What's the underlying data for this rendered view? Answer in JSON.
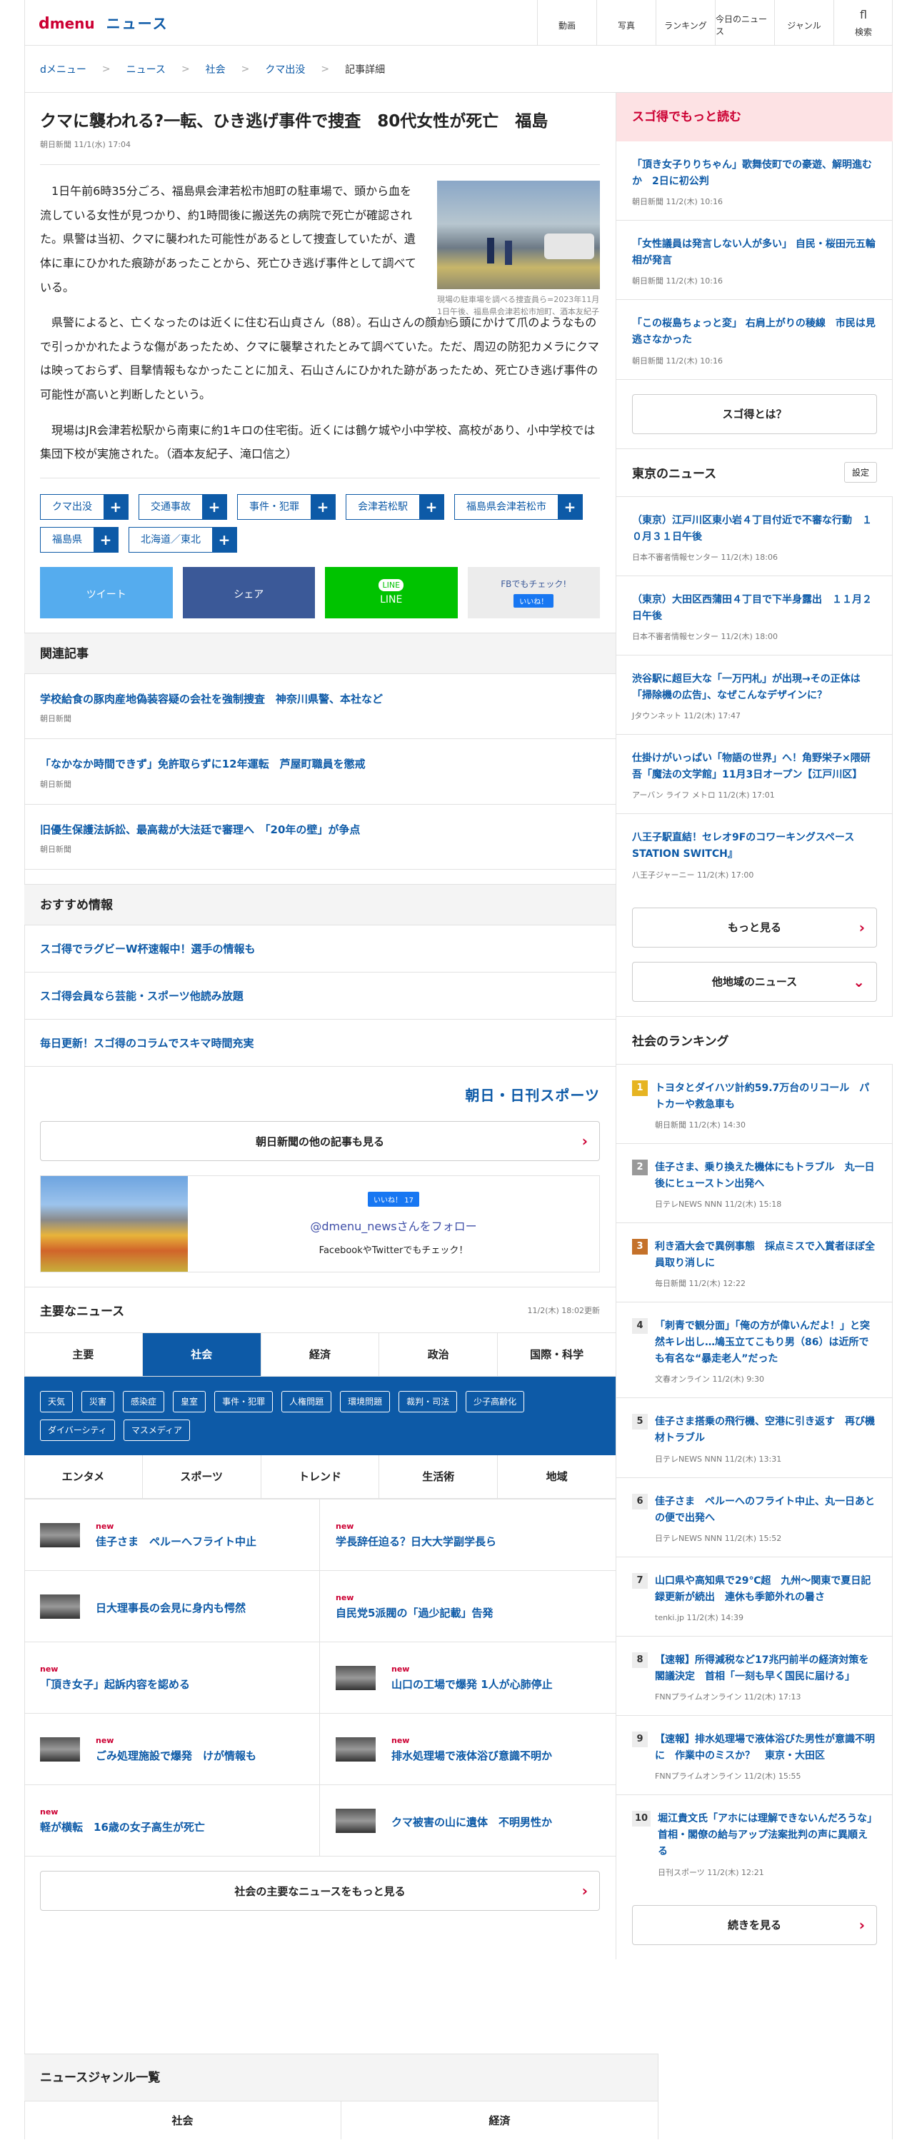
{
  "header": {
    "logo_d": "d",
    "logo_menu": "menu",
    "section": "ニュース",
    "nav": [
      {
        "icon": "",
        "label": "動画"
      },
      {
        "icon": "",
        "label": "写真"
      },
      {
        "icon": "",
        "label": "ランキング"
      },
      {
        "icon": "",
        "label": "今日のニュース"
      },
      {
        "icon": "",
        "label": "ジャンル"
      },
      {
        "icon": "fl",
        "label": "検索"
      }
    ]
  },
  "breadcrumb": [
    "dメニュー",
    "ニュース",
    "社会",
    "クマ出没",
    "記事詳細"
  ],
  "article": {
    "title": "クマに襲われる?一転、ひき逃げ事件で捜査　80代女性が死亡　福島",
    "meta": "朝日新聞 11/1(水) 17:04",
    "photo_caption": "現場の駐車場を調べる捜査員ら=2023年11月1日午後、福島県会津若松市旭町、酒本友紀子撮影",
    "paragraphs": [
      "1日午前6時35分ごろ、福島県会津若松市旭町の駐車場で、頭から血を流している女性が見つかり、約1時間後に搬送先の病院で死亡が確認された。県警は当初、クマに襲われた可能性があるとして捜査していたが、遺体に車にひかれた痕跡があったことから、死亡ひき逃げ事件として調べている。",
      "県警によると、亡くなったのは近くに住む石山貞さん（88）。石山さんの顔から頭にかけて爪のようなもので引っかかれたような傷があったため、クマに襲撃されたとみて調べていた。ただ、周辺の防犯カメラにクマは映っておらず、目撃情報もなかったことに加え、石山さんにひかれた跡があったため、死亡ひき逃げ事件の可能性が高いと判断したという。",
      "現場はJR会津若松駅から南東に約1キロの住宅街。近くには鶴ケ城や小中学校、高校があり、小中学校では集団下校が実施された。（酒本友紀子、滝口信之）"
    ],
    "tags": [
      "クマ出没",
      "交通事故",
      "事件・犯罪",
      "会津若松駅",
      "福島県会津若松市",
      "福島県",
      "北海道／東北"
    ],
    "share": {
      "tweet": "ツイート",
      "share": "シェア",
      "line": "LINE",
      "fb_check": "FBでもチェック!",
      "like": "いいね！"
    }
  },
  "related": {
    "heading": "関連記事",
    "items": [
      {
        "title": "学校給食の豚肉産地偽装容疑の会社を強制捜査　神奈川県警、本社など",
        "source": "朝日新聞"
      },
      {
        "title": "「なかなか時間できず」免許取らずに12年運転　芦屋町職員を懲戒",
        "source": "朝日新聞"
      },
      {
        "title": "旧優生保護法訴訟、最高裁が大法廷で審理へ　「20年の壁」が争点",
        "source": "朝日新聞"
      }
    ]
  },
  "recommend": {
    "heading": "おすすめ情報",
    "items": [
      "スゴ得でラグビーW杯速報中！選手の情報も",
      "スゴ得会員なら芸能・スポーツ他読み放題",
      "毎日更新！スゴ得のコラムでスキマ時間充実"
    ],
    "brand": "朝日・日刊スポーツ",
    "more_button": "朝日新聞の他の記事も見る"
  },
  "fb_follow": {
    "like": "いいね！ 17",
    "handle": "@dmenu_newsさんをフォロー",
    "sub": "FacebookやTwitterでもチェック！"
  },
  "top_news": {
    "heading": "主要なニュース",
    "updated": "11/2(木) 18:02更新",
    "tabs_row1": [
      "主要",
      "社会",
      "経済",
      "政治",
      "国際・科学"
    ],
    "tabs_row2": [
      "エンタメ",
      "スポーツ",
      "トレンド",
      "生活術",
      "地域"
    ],
    "subtags": [
      "天気",
      "災害",
      "感染症",
      "皇室",
      "事件・犯罪",
      "人権問題",
      "環境問題",
      "裁判・司法",
      "少子高齢化",
      "ダイバーシティ",
      "マスメディア"
    ],
    "items": [
      {
        "new": "new",
        "title": "佳子さま　ペルーへフライト中止",
        "thumb": true
      },
      {
        "new": "new",
        "title": "学長辞任迫る？日大大学副学長ら",
        "thumb": false
      },
      {
        "new": "",
        "title": "日大理事長の会見に身内も愕然",
        "thumb": true
      },
      {
        "new": "new",
        "title": "自民党5派閥の「過少記載」告発",
        "thumb": false
      },
      {
        "new": "new",
        "title": "「頂き女子」起訴内容を認める",
        "thumb": false
      },
      {
        "new": "new",
        "title": "山口の工場で爆発 1人が心肺停止",
        "thumb": true
      },
      {
        "new": "new",
        "title": "ごみ処理施設で爆発　けが情報も",
        "thumb": true
      },
      {
        "new": "new",
        "title": "排水処理場で液体浴び意識不明か",
        "thumb": true
      },
      {
        "new": "new",
        "title": "軽が横転　16歳の女子高生が死亡",
        "thumb": false
      },
      {
        "new": "",
        "title": "クマ被害の山に遺体　不明男性か",
        "thumb": true
      }
    ],
    "more_button": "社会の主要なニュースをもっと見る"
  },
  "genre": {
    "heading": "ニュースジャンル一覧",
    "items": [
      "社会",
      "経済"
    ]
  },
  "sidebar": {
    "sugotoku": {
      "heading": "スゴ得でもっと読む",
      "items": [
        {
          "title": "「頂き女子りりちゃん」歌舞伎町での豪遊、解明進むか　2日に初公判",
          "meta": "朝日新聞 11/2(木) 10:16"
        },
        {
          "title": "「女性議員は発言しない人が多い」 自民・桜田元五輪相が発言",
          "meta": "朝日新聞 11/2(木) 10:16"
        },
        {
          "title": "「この桜島ちょっと変」 右肩上がりの稜線　市民は見逃さなかった",
          "meta": "朝日新聞 11/2(木) 10:16"
        }
      ],
      "button": "スゴ得とは？"
    },
    "tokyo": {
      "heading": "東京のニュース",
      "settings": "設定",
      "items": [
        {
          "title": "（東京）江戸川区東小岩４丁目付近で不審な行動　１０月３１日午後",
          "meta": "日本不審者情報センター 11/2(木) 18:06"
        },
        {
          "title": "（東京）大田区西蒲田４丁目で下半身露出　１１月２日午後",
          "meta": "日本不審者情報センター 11/2(木) 18:00"
        },
        {
          "title": "渋谷駅に超巨大な「一万円札」が出現→その正体は「掃除機の広告」、なぜこんなデザインに？",
          "meta": "Jタウンネット 11/2(木) 17:47"
        },
        {
          "title": "仕掛けがいっぱい「物語の世界」へ！角野栄子×隈研吾「魔法の文学館」11月3日オープン【江戸川区】",
          "meta": "アーバン ライフ メトロ 11/2(木) 17:01"
        },
        {
          "title": "八王子駅直結！セレオ9FのコワーキングスペースSTATION SWITCH』",
          "meta": "八王子ジャーニー 11/2(木) 17:00"
        }
      ],
      "more": "もっと見る",
      "other": "他地域のニュース"
    },
    "ranking": {
      "heading": "社会のランキング",
      "items": [
        {
          "rank": "1",
          "title": "トヨタとダイハツ計約59.7万台のリコール　パトカーや救急車も",
          "meta": "朝日新聞 11/2(木) 14:30"
        },
        {
          "rank": "2",
          "title": "佳子さま、乗り換えた機体にもトラブル　丸一日後にヒューストン出発へ",
          "meta": "日テレNEWS NNN 11/2(木) 15:18"
        },
        {
          "rank": "3",
          "title": "利き酒大会で異例事態　採点ミスで入賞者ほぼ全員取り消しに",
          "meta": "毎日新聞 11/2(木) 12:22"
        },
        {
          "rank": "4",
          "title": "「刺青で観分面」「俺の方が偉いんだよ！」と突然キレ出し…鳩玉立てこもり男（86）は近所でも有名な“暴走老人”だった",
          "meta": "文春オンライン 11/2(木) 9:30"
        },
        {
          "rank": "5",
          "title": "佳子さま搭乗の飛行機、空港に引き返す　再び機材トラブル",
          "meta": "日テレNEWS NNN 11/2(木) 13:31"
        },
        {
          "rank": "6",
          "title": "佳子さま　ペルーへのフライト中止、丸一日あとの便で出発へ",
          "meta": "日テレNEWS NNN 11/2(木) 15:52"
        },
        {
          "rank": "7",
          "title": "山口県や高知県で29℃超　九州～関東で夏日記録更新が続出　連休も季節外れの暑さ",
          "meta": "tenki.jp 11/2(木) 14:39"
        },
        {
          "rank": "8",
          "title": "【速報】所得減税など17兆円前半の経済対策を閣議決定　首相「一刻も早く国民に届ける」",
          "meta": "FNNプライムオンライン 11/2(木) 17:13"
        },
        {
          "rank": "9",
          "title": "【速報】排水処理場で液体浴びた男性が意識不明に　作業中のミスか？　東京・大田区",
          "meta": "FNNプライムオンライン 11/2(木) 15:55"
        },
        {
          "rank": "10",
          "title": "堀江貴文氏「アホには理解できないんだろうな」首相・閣僚の給与アップ法案批判の声に異順える",
          "meta": "日刊スポーツ 11/2(木) 12:21"
        }
      ],
      "more": "続きを見る"
    }
  },
  "colors": {
    "brand_red": "#cc0033",
    "link_blue": "#0d5aa7",
    "twitter": "#55acee",
    "facebook": "#3b5998",
    "line": "#00c300"
  }
}
